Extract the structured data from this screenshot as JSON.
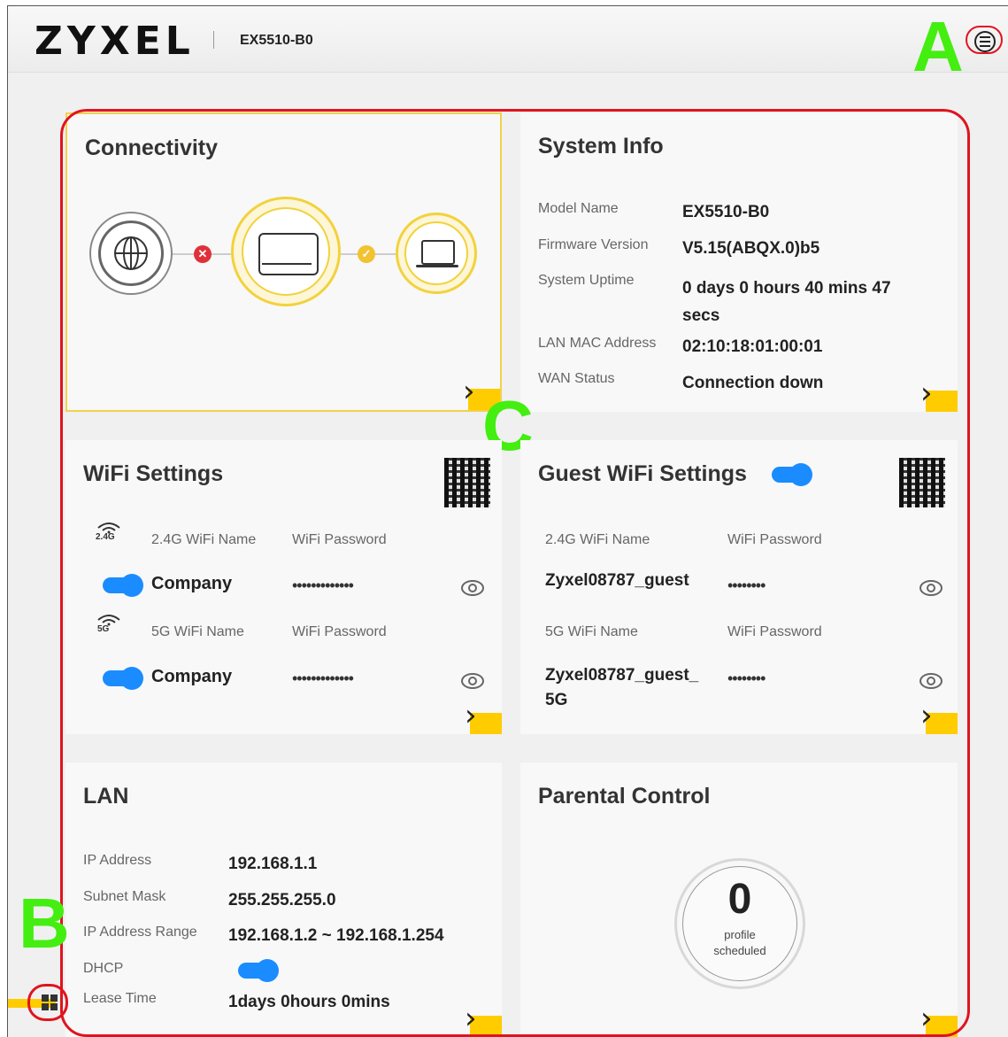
{
  "header": {
    "brand": "ZYXEL",
    "model": "EX5510-B0",
    "menu_icon": "hamburger-menu-icon"
  },
  "callouts": {
    "a": "A",
    "b": "B",
    "c": "C"
  },
  "connectivity": {
    "title": "Connectivity",
    "icons": [
      "globe-icon",
      "error-x-icon",
      "router-icon",
      "check-icon",
      "laptop-icon"
    ]
  },
  "system_info": {
    "title": "System Info",
    "rows": [
      {
        "label": "Model Name",
        "value": "EX5510-B0"
      },
      {
        "label": "Firmware Version",
        "value": "V5.15(ABQX.0)b5"
      },
      {
        "label": "System Uptime",
        "value": "0 days 0 hours 40 mins 47 secs"
      },
      {
        "label": "LAN MAC Address",
        "value": "02:10:18:01:00:01"
      },
      {
        "label": "WAN Status",
        "value": "Connection down"
      }
    ]
  },
  "wifi": {
    "title": "WiFi Settings",
    "bands": [
      {
        "badge": "2.4G",
        "name_label": "2.4G WiFi Name",
        "pw_label": "WiFi Password",
        "name": "Company",
        "password": "•••••••••••••"
      },
      {
        "badge": "5G",
        "name_label": "5G WiFi Name",
        "pw_label": "WiFi Password",
        "name": "Company",
        "password": "•••••••••••••"
      }
    ]
  },
  "guest_wifi": {
    "title": "Guest WiFi Settings",
    "bands": [
      {
        "name_label": "2.4G WiFi Name",
        "pw_label": "WiFi Password",
        "name": "Zyxel08787_guest",
        "password": "••••••••"
      },
      {
        "name_label": "5G WiFi Name",
        "pw_label": "WiFi Password",
        "name": "Zyxel08787_guest_\n5G",
        "password": "••••••••"
      }
    ]
  },
  "lan": {
    "title": "LAN",
    "rows": [
      {
        "label": "IP Address",
        "value": "192.168.1.1"
      },
      {
        "label": "Subnet Mask",
        "value": "255.255.255.0"
      },
      {
        "label": "IP Address Range",
        "value": "192.168.1.2 ~ 192.168.1.254"
      },
      {
        "label": "DHCP",
        "value": ""
      },
      {
        "label": "Lease Time",
        "value": "1days 0hours 0mins"
      }
    ]
  },
  "parental": {
    "title": "Parental Control",
    "count": "0",
    "caption_line1": "profile",
    "caption_line2": "scheduled"
  },
  "arrow_glyph": "›",
  "colors": {
    "accent": "#ffcc00",
    "toggle": "#1a8cff",
    "highlight": "#e0141e",
    "callout": "#44ee11"
  }
}
